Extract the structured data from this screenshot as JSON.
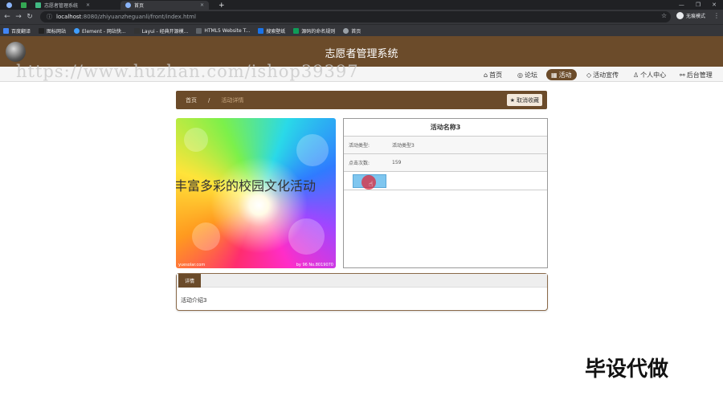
{
  "browser": {
    "tabs": [
      {
        "label": "志愿者管理系统",
        "active": false
      },
      {
        "label": "首页",
        "active": true
      }
    ],
    "url_host": "localhost",
    "url_path": ":8080/zhiyuanzheguanli/front/index.html",
    "profile_label": "无痕模式",
    "bookmarks": [
      "百度翻译",
      "图标网站",
      "Element - 网站快...",
      "Layui - 经典开源模...",
      "HTML5 Website T...",
      "搜索壁纸",
      "源码的命名规则",
      "首页"
    ]
  },
  "header": {
    "site_title": "志愿者管理系统"
  },
  "nav": {
    "items": [
      {
        "label": "首页",
        "icon": "home-icon"
      },
      {
        "label": "论坛",
        "icon": "chat-icon"
      },
      {
        "label": "活动",
        "icon": "grid-icon",
        "active": true
      },
      {
        "label": "活动宣传",
        "icon": "tag-icon"
      },
      {
        "label": "个人中心",
        "icon": "user-icon"
      },
      {
        "label": "后台管理",
        "icon": "link-icon"
      }
    ]
  },
  "watermark": "https://www.huzhan.com/ishop39397",
  "breadcrumb": {
    "items": [
      "首页",
      "活动详情"
    ],
    "separator": "/",
    "favorite_button": "取消收藏"
  },
  "hero": {
    "text": "丰富多彩的校园文化活动",
    "caption_left": "yuesolar.com",
    "caption_right": "by 96 No.8019070"
  },
  "info": {
    "title": "活动名称3",
    "rows": [
      {
        "label": "活动类型:",
        "value": "活动类型3"
      },
      {
        "label": "点击次数:",
        "value": "159"
      }
    ]
  },
  "details": {
    "tab": "详情",
    "content": "活动介绍3"
  },
  "corner_watermark": "毕设代做",
  "colors": {
    "brand_brown": "#6b4b2a",
    "button_blue": "#7fc6ef"
  }
}
